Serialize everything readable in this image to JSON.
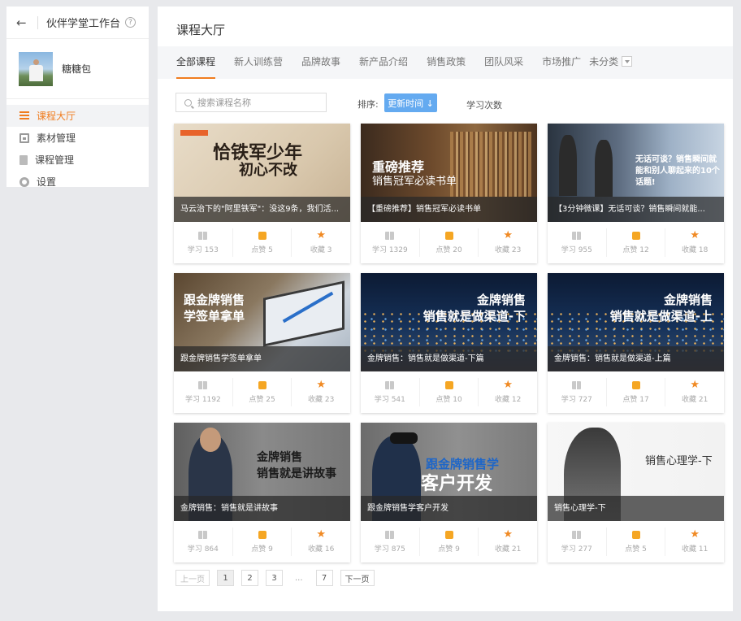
{
  "sidebar": {
    "title": "伙伴学堂工作台",
    "help": "?",
    "username": "糖糖包",
    "nav": [
      {
        "label": "课程大厅"
      },
      {
        "label": "素材管理"
      },
      {
        "label": "课程管理"
      },
      {
        "label": "设置"
      }
    ]
  },
  "main": {
    "title": "课程大厅",
    "tabs": [
      "全部课程",
      "新人训练营",
      "品牌故事",
      "新产品介绍",
      "销售政策",
      "团队风采",
      "市场推广",
      "未分类"
    ],
    "search_placeholder": "搜索课程名称",
    "sort_label": "排序:",
    "sort_active": "更新时间 ↓",
    "sort_other": "学习次数"
  },
  "stat_labels": {
    "study": "学习",
    "like": "点赞",
    "fav": "收藏"
  },
  "cards": [
    {
      "caption": "马云治下的\"阿里铁军\"：没这9条，我们活...",
      "overlay": [
        "恰铁军少年",
        "初心不改"
      ],
      "study": "153",
      "like": "5",
      "fav": "3"
    },
    {
      "caption": "【重磅推荐】销售冠军必读书单",
      "overlay": [
        "重磅推荐",
        "销售冠军必读书单"
      ],
      "study": "1329",
      "like": "20",
      "fav": "23"
    },
    {
      "caption": "【3分钟微课】无话可谈？销售瞬间就能...",
      "overlay": [
        "无话可谈？销售瞬间就",
        "能和别人聊起来的10个",
        "话题!"
      ],
      "study": "955",
      "like": "12",
      "fav": "18"
    },
    {
      "caption": "跟金牌销售学签单拿单",
      "overlay": [
        "跟金牌销售",
        "学签单拿单"
      ],
      "study": "1192",
      "like": "25",
      "fav": "23"
    },
    {
      "caption": "金牌销售：销售就是做渠道-下篇",
      "overlay": [
        "金牌销售",
        "销售就是做渠道-下"
      ],
      "study": "541",
      "like": "10",
      "fav": "12"
    },
    {
      "caption": "金牌销售：销售就是做渠道-上篇",
      "overlay": [
        "金牌销售",
        "销售就是做渠道-上"
      ],
      "study": "727",
      "like": "17",
      "fav": "21"
    },
    {
      "caption": "金牌销售：销售就是讲故事",
      "overlay": [
        "金牌销售",
        "销售就是讲故事"
      ],
      "study": "864",
      "like": "9",
      "fav": "16"
    },
    {
      "caption": "跟金牌销售学客户开发",
      "overlay": [
        "跟金牌销售学",
        "客户开发"
      ],
      "study": "875",
      "like": "9",
      "fav": "21"
    },
    {
      "caption": "销售心理学-下",
      "overlay": [
        "销售心理学-下"
      ],
      "study": "277",
      "like": "5",
      "fav": "11"
    }
  ],
  "pager": {
    "prev": "上一页",
    "pages": [
      "1",
      "2",
      "3"
    ],
    "ellipsis": "...",
    "last": "7",
    "next": "下一页"
  }
}
